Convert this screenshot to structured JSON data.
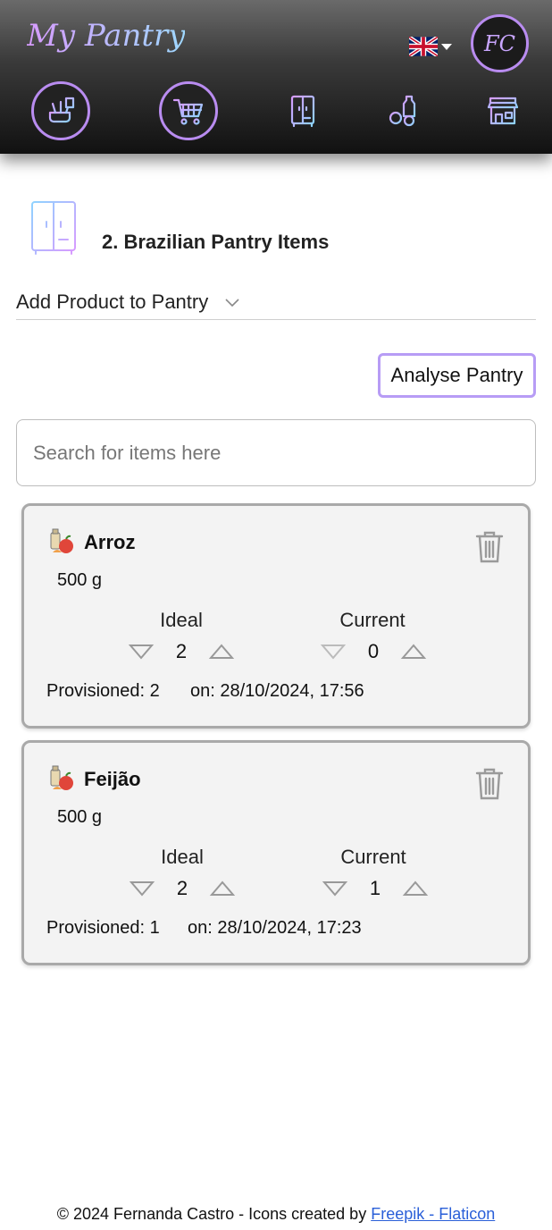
{
  "header": {
    "app_title": "My Pantry",
    "avatar_initials": "FC",
    "language": "en-GB",
    "nav": [
      {
        "icon": "kitchen-products-icon"
      },
      {
        "icon": "shopping-cart-icon"
      },
      {
        "icon": "pantry-cupboard-icon"
      },
      {
        "icon": "groceries-icon"
      },
      {
        "icon": "store-icon"
      }
    ]
  },
  "pantry": {
    "title": "2. Brazilian Pantry Items",
    "add_product_label": "Add Product to Pantry",
    "analyse_button": "Analyse Pantry",
    "search_placeholder": "Search for items here"
  },
  "items": [
    {
      "name": "Arroz",
      "size": "500 g",
      "ideal_label": "Ideal",
      "current_label": "Current",
      "ideal": "2",
      "current": "0",
      "provisioned": "Provisioned: 2",
      "date": "on: 28/10/2024, 17:56"
    },
    {
      "name": "Feijão",
      "size": "500 g",
      "ideal_label": "Ideal",
      "current_label": "Current",
      "ideal": "2",
      "current": "1",
      "provisioned": "Provisioned: 1",
      "date": "on: 28/10/2024, 17:23"
    }
  ],
  "footer": {
    "text": "© 2024 Fernanda Castro - Icons created by ",
    "link": "Freepik - Flaticon"
  },
  "colors": {
    "accent_purple": "#b98cf0",
    "accent_blue": "#9fd8ff",
    "card_bg": "#f3f3f3",
    "link": "#2a5fd8"
  }
}
